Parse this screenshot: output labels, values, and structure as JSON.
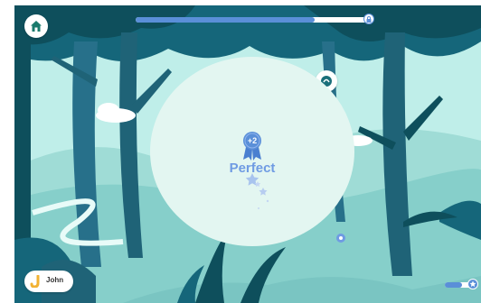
{
  "game": {
    "score_badge": "+2",
    "result_label": "Perfect",
    "level_progress": 0.76,
    "stars_progress": 0.55
  },
  "user": {
    "name": "John"
  },
  "icons": {
    "home": "home-icon",
    "hint": "hint-icon",
    "progress_end": "lock-icon",
    "avatar": "letter-j-avatar",
    "stars_end": "star-icon"
  },
  "colors": {
    "accent": "#5a8fd8",
    "result_text": "#6f9be3",
    "forest_dark": "#0e4f5c",
    "sky": "#bfeee9"
  }
}
